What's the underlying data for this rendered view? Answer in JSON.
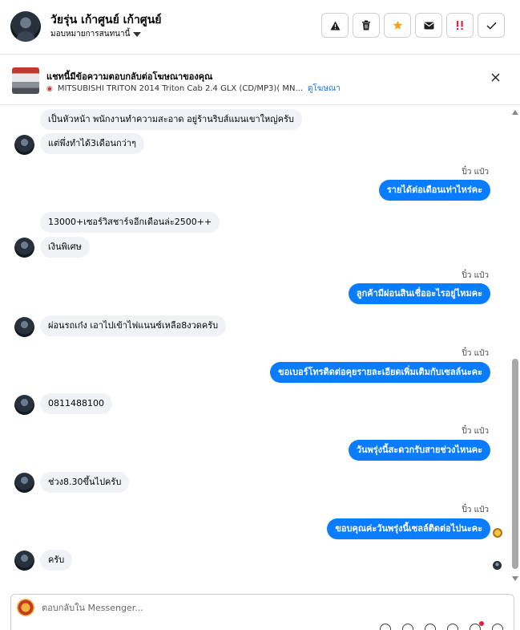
{
  "header": {
    "contact_name": "วัยรุ่น เก้าศูนย์ เก้าศูนย์",
    "assign_label": "มอบหมายการสนทนานี้",
    "actions": [
      "warning-icon",
      "trash-icon",
      "star-icon",
      "envelope-icon",
      "spam-icon",
      "check-icon"
    ],
    "star_color": "#f7a21b",
    "spam_color": "#e41e3f"
  },
  "ad": {
    "title": "แชทนี้มีข้อความตอบกลับต่อโฆษณาของคุณ",
    "product": "MITSUBISHI TRITON 2014 Triton Cab 2.4 GLX (CD/MP3)( MN...",
    "link": "ดูโฆษณา"
  },
  "messages": [
    {
      "dir": "in",
      "text": "เป็นหัวหน้า พนักงานทำความสะอาด  อยู่ร้านริบส์แมนเขาใหญ่ครับ"
    },
    {
      "dir": "in",
      "text": "แต่พึ่งทำได้3เดือนกว่าๆ"
    },
    {
      "dir": "out",
      "sender": "ปิ๋ว แป๋ว",
      "text": "รายได้ต่อเดือนเท่าไหร่คะ"
    },
    {
      "dir": "in",
      "text": "13000+เซอร์วิสชาร์จอีกเดือนล่ะ2500++"
    },
    {
      "dir": "in",
      "text": "เงินพิเศษ"
    },
    {
      "dir": "out",
      "sender": "ปิ๋ว แป๋ว",
      "text": "ลูกค้ามีผ่อนสินเชื่ออะไรอยู่ไหมคะ"
    },
    {
      "dir": "in",
      "text": "ผ่อนรถเก๋ง เอาไปเข้าไฟแนนซ์เหลือ8งวดครับ"
    },
    {
      "dir": "out",
      "sender": "ปิ๋ว แป๋ว",
      "text": "ขอเบอร์โทรติดต่อคุยรายละเอียดเพิ่มเติมกับเซลล์นะคะ"
    },
    {
      "dir": "in",
      "text": "0811488100"
    },
    {
      "dir": "out",
      "sender": "ปิ๋ว แป๋ว",
      "text": "วันพรุ่งนี้สะดวกรับสายช่วงไหนคะ"
    },
    {
      "dir": "in",
      "text": "ช่วง8.30ขึ้นไปครับ"
    },
    {
      "dir": "out",
      "sender": "ปิ๋ว แป๋ว",
      "text": "ขอบคุณค่ะวันพรุ่งนี้เซลล์ติดต่อไปนะคะ"
    },
    {
      "dir": "in",
      "text": "ครับ"
    }
  ],
  "composer": {
    "placeholder": "ตอบกลับใน Messenger..."
  },
  "colors": {
    "outgoing_bubble": "#0a7cff",
    "incoming_bubble": "#f0f2f5",
    "link": "#1877f2"
  }
}
